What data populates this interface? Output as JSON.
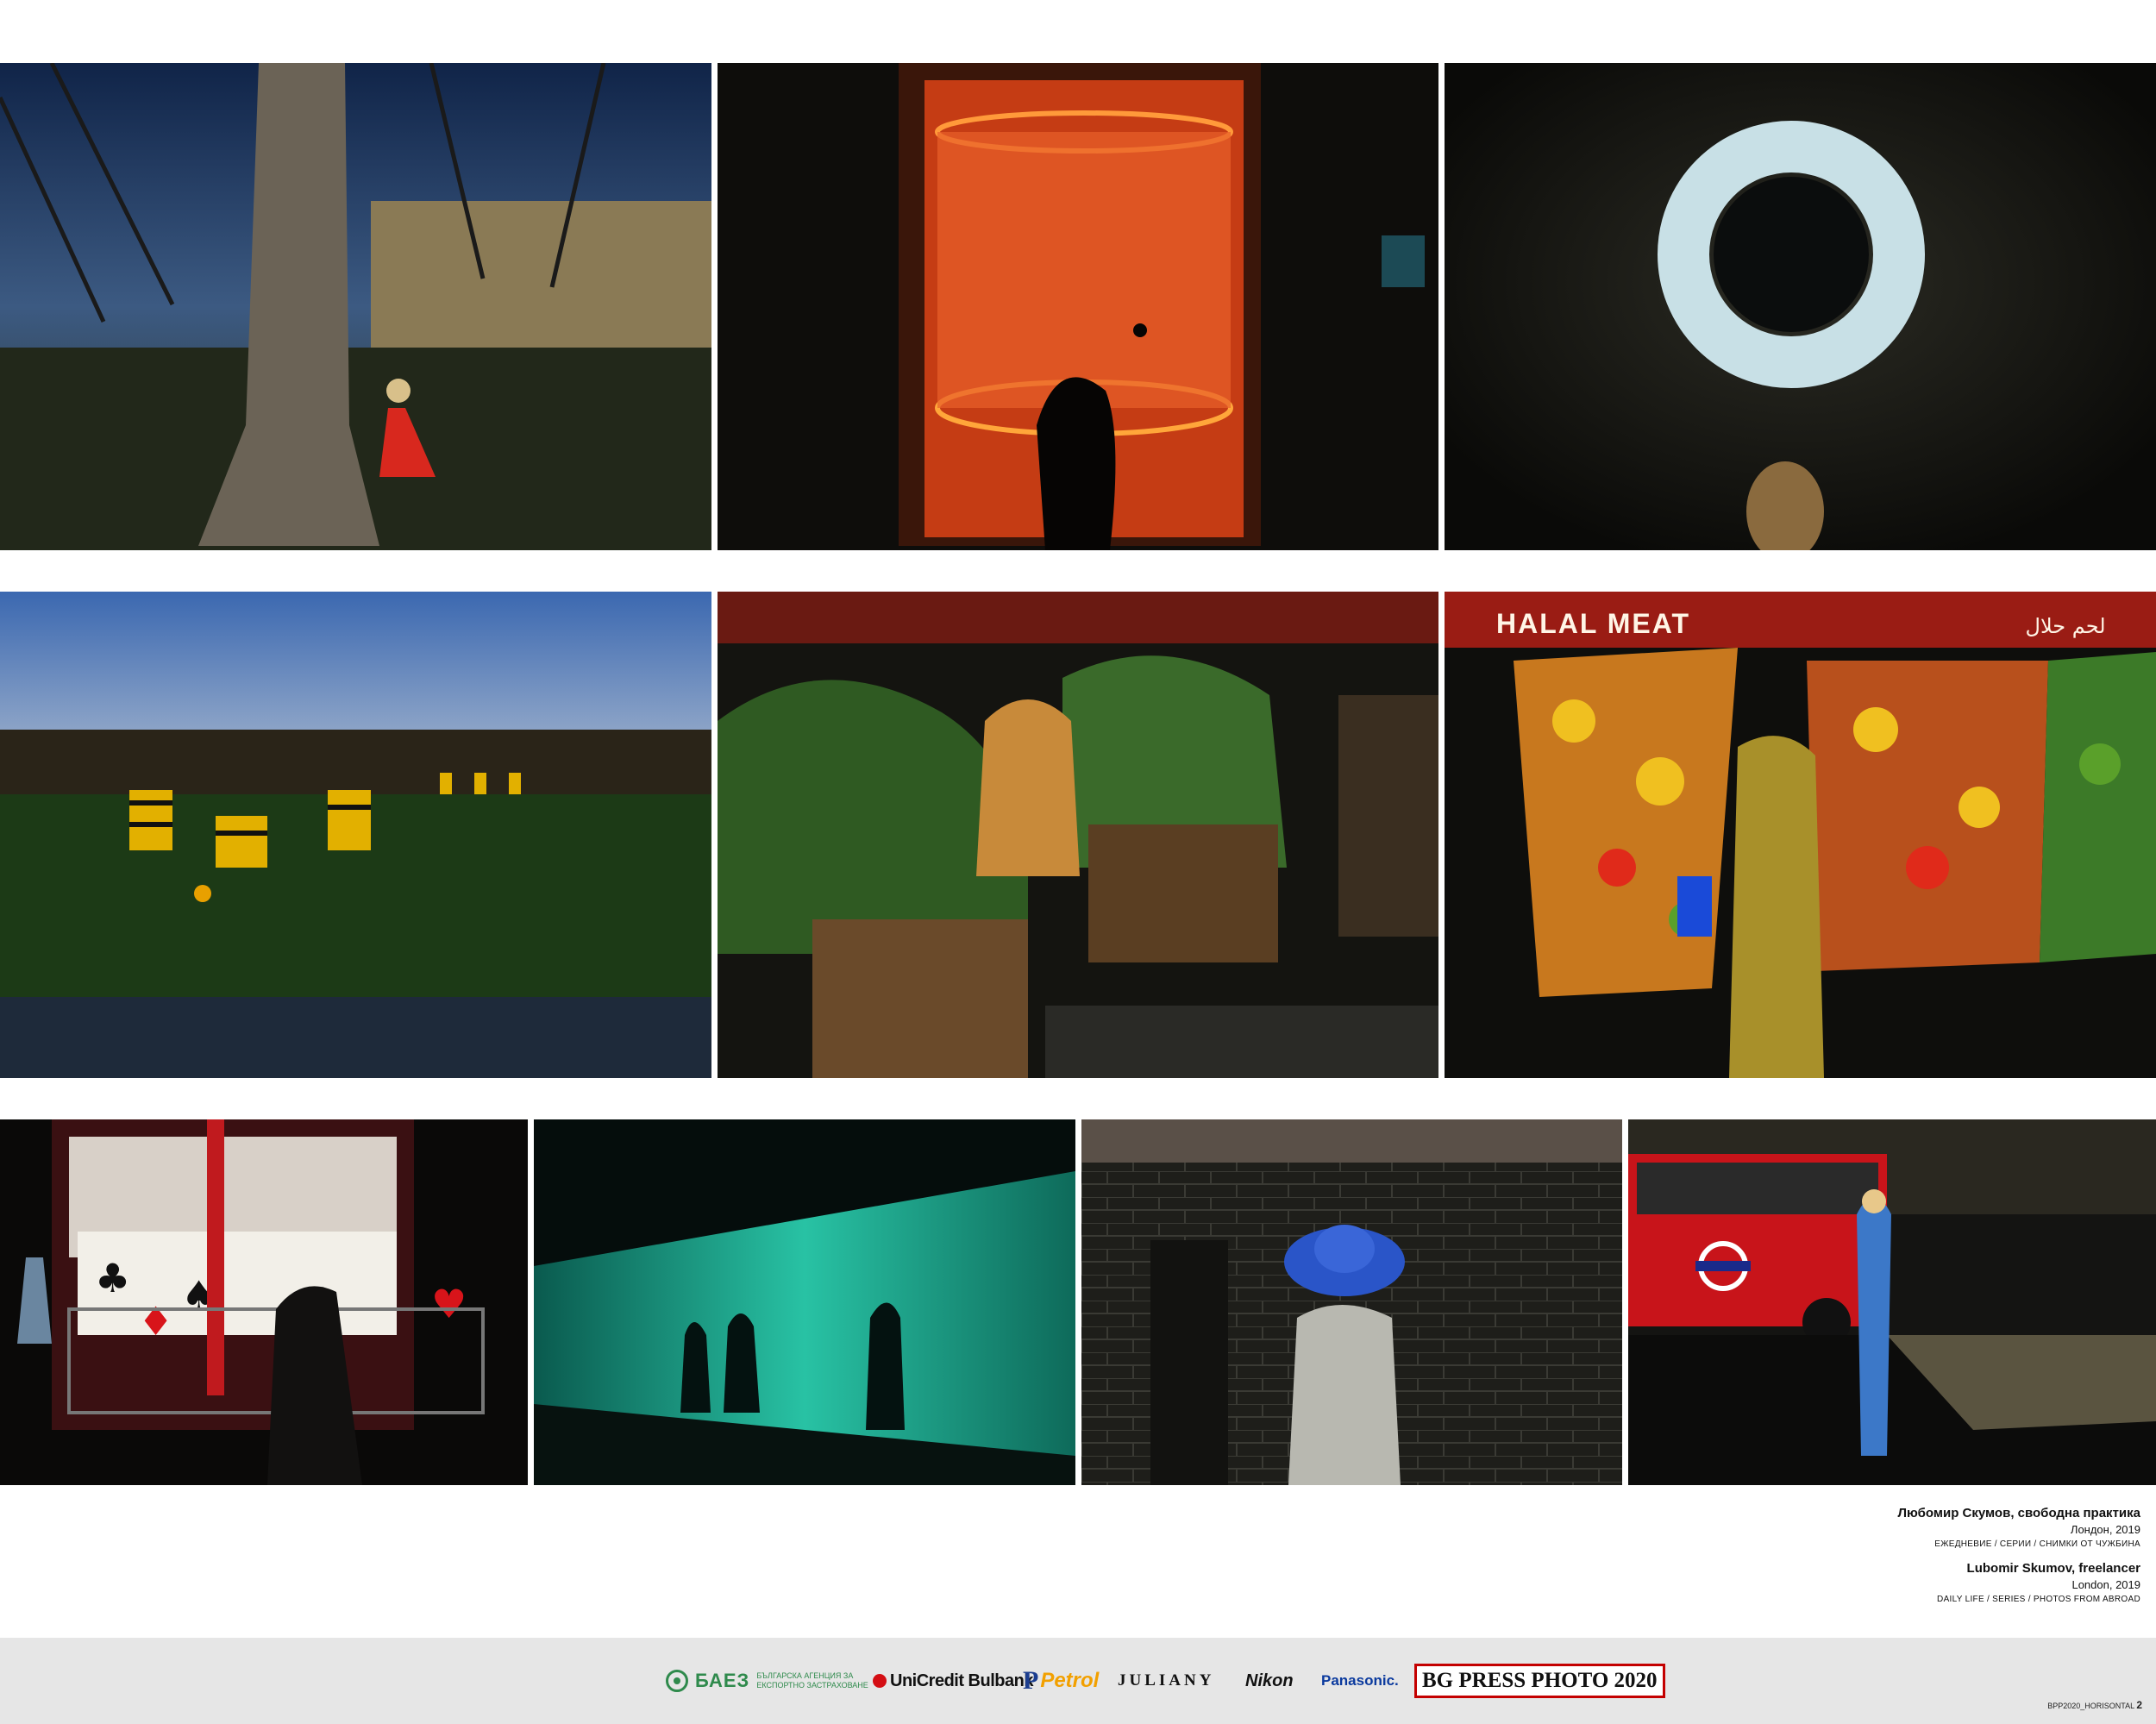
{
  "photos": [
    {
      "id": "park-tree",
      "label": "Park with tree and girl in red coat",
      "sky": "#1d3360",
      "ground": "#2a2f1c"
    },
    {
      "id": "orange-window",
      "label": "Girl silhouette before glowing orange window",
      "glow": "#e0481a"
    },
    {
      "id": "light-ring",
      "label": "Ring of light with boy's face",
      "ring": "#cfe3ea"
    },
    {
      "id": "football",
      "label": "Boys playing football in striped kits",
      "kit1": "#e8b400",
      "kit2": "#1a1a1a"
    },
    {
      "id": "tiger-planters",
      "label": "Woman with tiger shirt among planters"
    },
    {
      "id": "halal-meat",
      "label": "Fruit print curtains at market",
      "sign": "HALAL MEAT",
      "sign_arabic": "لحم حلال",
      "awning": "#9a1c14"
    },
    {
      "id": "card-carousel",
      "label": "Carousel with playing card symbols"
    },
    {
      "id": "teal-glass",
      "label": "Silhouettes against teal glass wall",
      "teal": "#1aa88e"
    },
    {
      "id": "blue-hat",
      "label": "Woman in blue hat before brick wall",
      "hat": "#2a55c8"
    },
    {
      "id": "red-bus",
      "label": "Woman in blue dress beside red bus",
      "bus": "#c8141a",
      "dress": "#3c78c8"
    }
  ],
  "caption": {
    "bg": {
      "name": "Любомир Скумов, свободна практика",
      "place": "Лондон, 2019",
      "category": "ЕЖЕДНЕВИЕ / СЕРИИ / СНИМКИ ОТ ЧУЖБИНА"
    },
    "en": {
      "name": "Lubomir Skumov, freelancer",
      "place": "London, 2019",
      "category": "DAILY LIFE / SERIES / PHOTOS FROM ABROAD"
    }
  },
  "sponsors": {
    "baez": {
      "name": "БАЕЗ",
      "sub": "БЪЛГАРСКА АГЕНЦИЯ ЗА ЕКСПОРТНО ЗАСТРАХОВАНЕ"
    },
    "unicredit": "UniCredit Bulbank",
    "petrol": "Petrol",
    "juliany": "JULIANY",
    "nikon": "Nikon",
    "panasonic": "Panasonic.",
    "bgpress": "BG PRESS PHOTO 2020"
  },
  "file_code": {
    "name": "BPP2020_HORISONTAL",
    "page": "2"
  }
}
